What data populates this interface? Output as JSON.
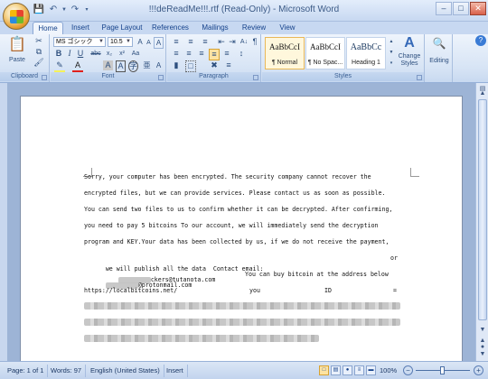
{
  "window": {
    "title": "!!!deReadMe!!!.rtf (Read-Only) - Microsoft Word"
  },
  "qat": {
    "save_icon": "save-icon",
    "undo_icon": "undo-icon",
    "redo_icon": "redo-icon"
  },
  "tabs": [
    {
      "label": "Home"
    },
    {
      "label": "Insert"
    },
    {
      "label": "Page Layout"
    },
    {
      "label": "References"
    },
    {
      "label": "Mailings"
    },
    {
      "label": "Review"
    },
    {
      "label": "View"
    }
  ],
  "ribbon": {
    "clipboard": {
      "label": "Clipboard",
      "paste_label": "Paste"
    },
    "font": {
      "label": "Font",
      "font_name": "MS ゴシック",
      "font_size": "10.5"
    },
    "paragraph": {
      "label": "Paragraph"
    },
    "styles": {
      "label": "Styles",
      "items": [
        {
          "sample": "AaBbCcI",
          "name": "¶ Normal"
        },
        {
          "sample": "AaBbCcI",
          "name": "¶ No Spac..."
        },
        {
          "sample": "AaBbCc",
          "name": "Heading 1"
        }
      ],
      "change_styles_label": "Change Styles"
    },
    "editing": {
      "label": "Editing"
    }
  },
  "document": {
    "lines": [
      "Sorry, your computer has been encrypted. The security company cannot recover the",
      "encrypted files, but we can provide services. Please contact us as soon as possible.",
      "You can send two files to us to confirm whether it can be decrypted. After confirming,",
      "you need to pay 5 bitcoins To our account, we will immediately send the decryption",
      "program and KEY.Your data has been collected by us, if we do not receive the payment,"
    ],
    "line6_prefix": "we will publish all the data  Contact email:",
    "line6_email_suffix": "ckers@tutanota.com",
    "line6_or": "or",
    "line7_email_suffix": "@protonmail.com",
    "line7_text": "You can buy bitcoin at the address below",
    "line8_url": "https://localbitcoins.net/",
    "line8_you": "you",
    "line8_id": "ID",
    "line8_eq": "="
  },
  "status": {
    "page": "Page: 1 of 1",
    "words": "Words: 97",
    "language": "English (United States)",
    "mode": "Insert",
    "zoom": "100%"
  }
}
